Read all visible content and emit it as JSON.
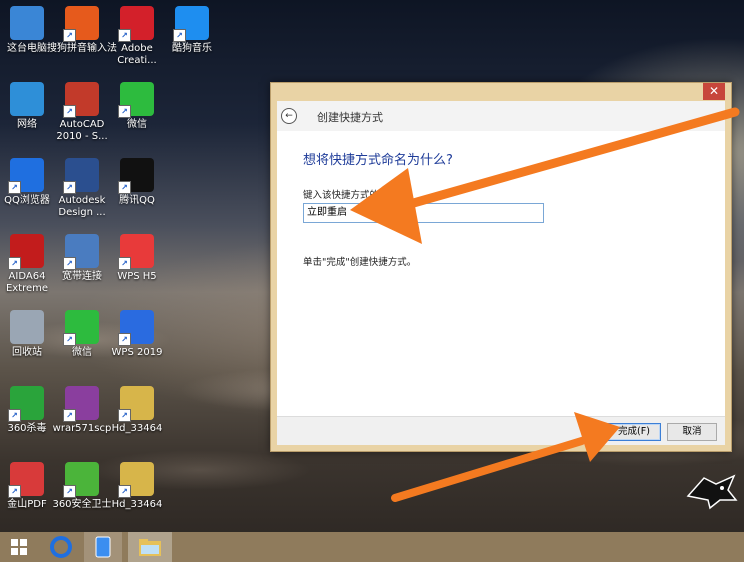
{
  "desktop_icons": [
    {
      "label": "这台电脑",
      "icon": "computer-icon",
      "color": "#3a86d6"
    },
    {
      "label": "搜狗拼音输入法",
      "icon": "sogou-icon",
      "color": "#e65a1c"
    },
    {
      "label": "Adobe Creati...",
      "icon": "adobe-cc-icon",
      "color": "#d3202a"
    },
    {
      "label": "酷狗音乐",
      "icon": "kugou-icon",
      "color": "#1e8ef0"
    },
    {
      "label": "网络",
      "icon": "network-icon",
      "color": "#2e8fd8"
    },
    {
      "label": "AutoCAD 2010 - S...",
      "icon": "autocad-icon",
      "color": "#c23a2a"
    },
    {
      "label": "微信",
      "icon": "wechat-icon",
      "color": "#2dbb3e"
    },
    {
      "label": "QQ浏览器",
      "icon": "qq-browser-icon",
      "color": "#1f6fe0"
    },
    {
      "label": "Autodesk Design ...",
      "icon": "autodesk-icon",
      "color": "#2b4f8f"
    },
    {
      "label": "腾讯QQ",
      "icon": "qq-icon",
      "color": "#111111"
    },
    {
      "label": "AIDA64 Extreme",
      "icon": "aida64-icon",
      "color": "#c21c1c"
    },
    {
      "label": "宽带连接",
      "icon": "broadband-icon",
      "color": "#4a7cc0"
    },
    {
      "label": "WPS H5",
      "icon": "wps-h5-icon",
      "color": "#e83a3a"
    },
    {
      "label": "回收站",
      "icon": "recycle-bin-icon",
      "color": "#9aa6b4"
    },
    {
      "label": "微信",
      "icon": "wechat-icon",
      "color": "#2dbb3e"
    },
    {
      "label": "WPS 2019",
      "icon": "wps-icon",
      "color": "#2a6be0"
    },
    {
      "label": "360杀毒",
      "icon": "360-antivirus-icon",
      "color": "#2aa43b"
    },
    {
      "label": "wrar571scp",
      "icon": "winrar-icon",
      "color": "#8a3e9e"
    },
    {
      "label": "Hd_33464",
      "icon": "archive-file-icon",
      "color": "#d7b54a"
    },
    {
      "label": "金山PDF",
      "icon": "kingsoft-pdf-icon",
      "color": "#d83a3a"
    },
    {
      "label": "360安全卫士",
      "icon": "360-safe-icon",
      "color": "#4bb43a"
    },
    {
      "label": "Hd_33464",
      "icon": "archive-file-icon",
      "color": "#d7b54a"
    }
  ],
  "dialog": {
    "title": "创建快捷方式",
    "heading": "想将快捷方式命名为什么?",
    "name_label": "键入该快捷方式的名",
    "name_value": "立即重启",
    "hint": "单击\"完成\"创建快捷方式。",
    "finish_label": "完成(F)",
    "cancel_label": "取消",
    "close_label": "✕"
  },
  "colors": {
    "accent_arrow": "#f47a20",
    "heading": "#1f3c99",
    "taskbar": "#8f7b5c"
  }
}
